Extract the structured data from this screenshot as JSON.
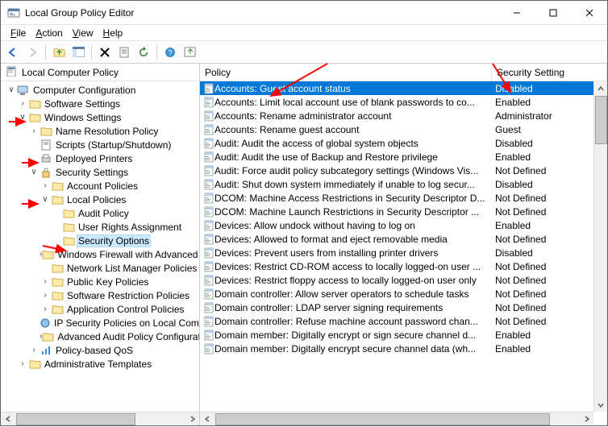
{
  "window": {
    "title": "Local Group Policy Editor"
  },
  "menu": {
    "file": "File",
    "action": "Action",
    "view": "View",
    "help": "Help"
  },
  "tree": {
    "header": "Local Computer Policy",
    "nodes": {
      "computer_config": "Computer Configuration",
      "software_settings": "Software Settings",
      "windows_settings": "Windows Settings",
      "name_res": "Name Resolution Policy",
      "scripts": "Scripts (Startup/Shutdown)",
      "deployed_printers": "Deployed Printers",
      "security_settings": "Security Settings",
      "account_policies": "Account Policies",
      "local_policies": "Local Policies",
      "audit_policy": "Audit Policy",
      "user_rights": "User Rights Assignment",
      "security_options": "Security Options",
      "windows_firewall": "Windows Firewall with Advanced Security",
      "network_list": "Network List Manager Policies",
      "public_key": "Public Key Policies",
      "software_restriction": "Software Restriction Policies",
      "app_control": "Application Control Policies",
      "ip_security": "IP Security Policies on Local Computer",
      "advanced_audit": "Advanced Audit Policy Configuration",
      "policy_qos": "Policy-based QoS",
      "admin_templates": "Administrative Templates"
    }
  },
  "list": {
    "col_policy": "Policy",
    "col_setting": "Security Setting",
    "rows": [
      {
        "p": "Accounts: Guest account status",
        "s": "Disabled",
        "sel": true
      },
      {
        "p": "Accounts: Limit local account use of blank passwords to co...",
        "s": "Enabled"
      },
      {
        "p": "Accounts: Rename administrator account",
        "s": "Administrator"
      },
      {
        "p": "Accounts: Rename guest account",
        "s": "Guest"
      },
      {
        "p": "Audit: Audit the access of global system objects",
        "s": "Disabled"
      },
      {
        "p": "Audit: Audit the use of Backup and Restore privilege",
        "s": "Enabled"
      },
      {
        "p": "Audit: Force audit policy subcategory settings (Windows Vis...",
        "s": "Not Defined"
      },
      {
        "p": "Audit: Shut down system immediately if unable to log secur...",
        "s": "Disabled"
      },
      {
        "p": "DCOM: Machine Access Restrictions in Security Descriptor D...",
        "s": "Not Defined"
      },
      {
        "p": "DCOM: Machine Launch Restrictions in Security Descriptor ...",
        "s": "Not Defined"
      },
      {
        "p": "Devices: Allow undock without having to log on",
        "s": "Enabled"
      },
      {
        "p": "Devices: Allowed to format and eject removable media",
        "s": "Not Defined"
      },
      {
        "p": "Devices: Prevent users from installing printer drivers",
        "s": "Disabled"
      },
      {
        "p": "Devices: Restrict CD-ROM access to locally logged-on user ...",
        "s": "Not Defined"
      },
      {
        "p": "Devices: Restrict floppy access to locally logged-on user only",
        "s": "Not Defined"
      },
      {
        "p": "Domain controller: Allow server operators to schedule tasks",
        "s": "Not Defined"
      },
      {
        "p": "Domain controller: LDAP server signing requirements",
        "s": "Not Defined"
      },
      {
        "p": "Domain controller: Refuse machine account password chan...",
        "s": "Not Defined"
      },
      {
        "p": "Domain member: Digitally encrypt or sign secure channel d...",
        "s": "Enabled"
      },
      {
        "p": "Domain member: Digitally encrypt secure channel data (wh...",
        "s": "Enabled"
      }
    ]
  }
}
